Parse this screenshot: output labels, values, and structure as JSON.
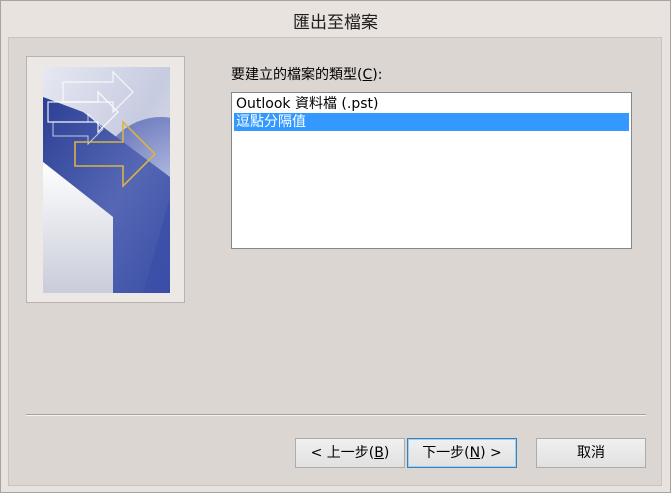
{
  "window": {
    "title": "匯出至檔案"
  },
  "prompt": {
    "text_before": "要建立的檔案的類型(",
    "accelerator": "C",
    "text_after": "):"
  },
  "file_types": [
    {
      "label": "Outlook 資料檔 (.pst)",
      "selected": false
    },
    {
      "label": "逗點分隔值",
      "selected": true
    }
  ],
  "buttons": {
    "back": {
      "before": "< 上一步(",
      "accel": "B",
      "after": ")"
    },
    "next": {
      "before": "下一步(",
      "accel": "N",
      "after": ") >"
    },
    "cancel": {
      "label": "取消"
    }
  },
  "colors": {
    "selection": "#3399ff",
    "dialog_background": "#dcd6d2",
    "title_background": "#e9e3df"
  },
  "icons": {
    "wizard_image": "export-arrows-illustration"
  }
}
